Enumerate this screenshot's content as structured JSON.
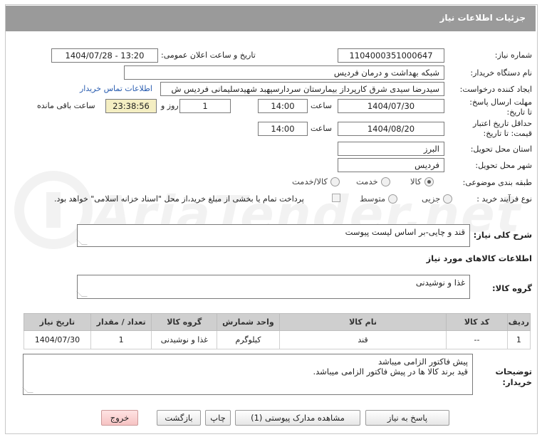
{
  "header": {
    "title": "جزئیات اطلاعات نیاز"
  },
  "fields": {
    "need_number_label": "شماره نیاز:",
    "need_number": "1104000351000647",
    "announce_label": "تاریخ و ساعت اعلان عمومی:",
    "announce_value": "1404/07/28 - 13:20",
    "buyer_label": "نام دستگاه خریدار:",
    "buyer_value": "شبکه بهداشت و درمان فردیس",
    "creator_label": "ایجاد کننده درخواست:",
    "creator_value": "سیدرضا سیدی شرق کارپرداز بیمارستان سردارسپهبد شهیدسلیمانی فردیس ش",
    "contact_link": "اطلاعات تماس خریدار",
    "reply_deadline_label": "مهلت ارسال پاسخ: تا تاریخ:",
    "reply_date": "1404/07/30",
    "time_label": "ساعت",
    "reply_time": "14:00",
    "days_value": "1",
    "days_label": "روز و",
    "remaining_time": "23:38:56",
    "remaining_label": "ساعت باقی مانده",
    "validity_label": "حداقل تاریخ اعتبار قیمت: تا تاریخ:",
    "validity_date": "1404/08/20",
    "validity_time": "14:00",
    "province_label": "استان محل تحویل:",
    "province_value": "البرز",
    "city_label": "شهر محل تحویل:",
    "city_value": "فردیس",
    "category_label": "طبقه بندی موضوعی:",
    "category_options": [
      "کالا",
      "خدمت",
      "کالا/خدمت"
    ],
    "process_label": "نوع فرآیند خرید :",
    "process_options": [
      "جزیی",
      "متوسط"
    ],
    "payment_note": "پرداخت تمام یا بخشی از مبلغ خرید،از محل \"اسناد خزانه اسلامی\" خواهد بود."
  },
  "summary": {
    "label": "شرح کلی نیاز:",
    "value": "قند و چایی-بر اساس لیست پیوست"
  },
  "goods_info_title": "اطلاعات کالاهای مورد نیاز",
  "goods_group": {
    "label": "گروه کالا:",
    "value": "غذا و نوشیدنی"
  },
  "table": {
    "headers": [
      "ردیف",
      "کد کالا",
      "نام کالا",
      "واحد شمارش",
      "گروه کالا",
      "تعداد / مقدار",
      "تاریخ نیاز"
    ],
    "rows": [
      [
        "1",
        "--",
        "قند",
        "کیلوگرم",
        "غذا و نوشیدنی",
        "1",
        "1404/07/30"
      ]
    ]
  },
  "buyer_notes": {
    "label": "توضیحات خریدار:",
    "line1": "پیش فاکتور الزامی میباشد",
    "line2": "قید برند کالا ها در پیش فاکتور الزامی میباشد."
  },
  "buttons": {
    "reply": "پاسخ به نیاز",
    "attachments": "مشاهده مدارک پیوستی (1)",
    "print": "چاپ",
    "back": "بازگشت",
    "exit": "خروج"
  },
  "watermark": {
    "text": "AriaTender.net"
  },
  "colors": {
    "header": "#9a9a9a",
    "link": "#2a5db0",
    "remaining_bg": "#f4eec2",
    "exit_button": "#f6c3c3"
  }
}
